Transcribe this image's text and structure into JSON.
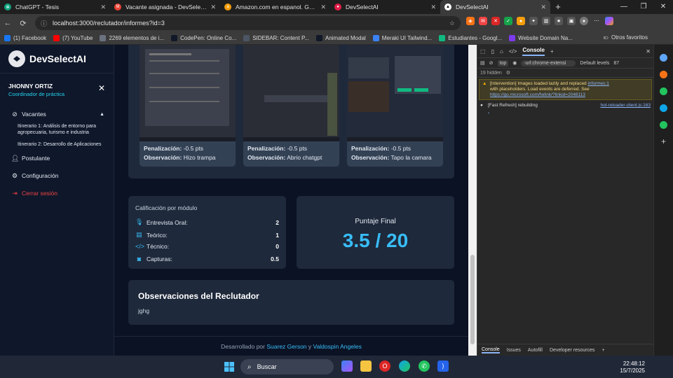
{
  "browser": {
    "tabs": [
      {
        "title": "ChatGPT - Tesis",
        "color": "#10a37f",
        "glyph": "✻"
      },
      {
        "title": "Vacante asignada - DevSelectAI -",
        "color": "#ea4335",
        "glyph": "M"
      },
      {
        "title": "Amazon.com en espanol. Gasta m",
        "color": "#f59e0b",
        "glyph": "a"
      },
      {
        "title": "DevSelectAI",
        "color": "#e11d48",
        "glyph": "●"
      },
      {
        "title": "DevSelectAI",
        "color": "#ffffff",
        "glyph": "▲"
      }
    ],
    "active_tab_index": 4,
    "url": "localhost:3000/reclutador/informes?id=3",
    "bookmarks": [
      {
        "label": "(1) Facebook",
        "color": "#1877f2"
      },
      {
        "label": "(7) YouTube",
        "color": "#ff0000"
      },
      {
        "label": "2269 elementos de i...",
        "color": "#6b7280"
      },
      {
        "label": "CodePen: Online Co...",
        "color": "#111827"
      },
      {
        "label": "SIDEBAR: Content P...",
        "color": "#4b5563"
      },
      {
        "label": "Animated Modal",
        "color": "#111827"
      },
      {
        "label": "Meraki UI Tailwind...",
        "color": "#3b82f6"
      },
      {
        "label": "Estudiantes - Googl...",
        "color": "#10b981"
      },
      {
        "label": "Website Domain Na...",
        "color": "#7c3aed"
      }
    ],
    "other_bookmarks": "Otros favoritos"
  },
  "app": {
    "logo_text": "DevSelectAI",
    "user": {
      "name": "JHONNY ORTIZ",
      "role": "Coordinador de práctica"
    },
    "menu": {
      "vacantes": "Vacantes",
      "itinerario1": "Itinerario 1: Análisis de entorno para agropecuaria, turismo e industria",
      "itinerario2": "Itinerario 2: Desarrollo de Aplicaciones",
      "postulante": "Postulante",
      "configuracion": "Configuración",
      "logout": "Cerrar sesión"
    },
    "captures": [
      {
        "penalty_label": "Penalización:",
        "penalty_value": "-0.5 pts",
        "obs_label": "Observación:",
        "obs_value": "Hizo trampa"
      },
      {
        "penalty_label": "Penalización:",
        "penalty_value": "-0.5 pts",
        "obs_label": "Observación:",
        "obs_value": "Abrio chatgpt"
      },
      {
        "penalty_label": "Penalización:",
        "penalty_value": "-0.5 pts",
        "obs_label": "Observación:",
        "obs_value": "Tapo la camara"
      }
    ],
    "modules": {
      "title": "Calificación por módulo",
      "rows": [
        {
          "label": "Entrevista Oral:",
          "value": "2"
        },
        {
          "label": "Teórico:",
          "value": "1"
        },
        {
          "label": "Técnico:",
          "value": "0"
        },
        {
          "label": "Capturas:",
          "value": "0.5"
        }
      ]
    },
    "final": {
      "label": "Puntaje Final",
      "score": "3.5 / 20"
    },
    "observations": {
      "title": "Observaciones del Reclutador",
      "text": "jghg"
    },
    "footer": {
      "prefix": "Desarrollado por",
      "author1": "Suarez Gerson",
      "joiner": "y",
      "author2": "Valdospin Angeles"
    }
  },
  "devtools": {
    "tab": "Console",
    "context": "top",
    "filter": "-url:chrome-extensi",
    "levels": "Default levels",
    "issues": "87",
    "hidden": "19 hidden",
    "warning": {
      "text1": "[Intervention] Images loaded lazily and replaced",
      "link1": "informes:1",
      "text2": "with placeholders. Load events are deferred. See",
      "link2": "https://go.microsoft.com/fwlink/?linkid=2048113"
    },
    "log": {
      "text": "[Fast Refresh] rebuilding",
      "src": "hot-reloader-client.js:163"
    },
    "bottom_tabs": [
      "Console",
      "Issues",
      "Autofill",
      "Developer resources"
    ]
  },
  "taskbar": {
    "search": "Buscar",
    "time": "22:48:12",
    "date": "15/7/2025"
  }
}
